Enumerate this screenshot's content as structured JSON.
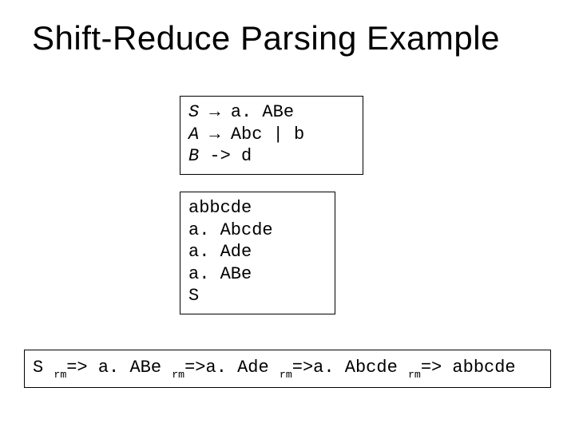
{
  "title": "Shift-Reduce Parsing Example",
  "grammar": {
    "rule1": {
      "lhs": "S",
      "arrow": "→",
      "rhs": "a. ABe"
    },
    "rule2": {
      "lhs": "A",
      "arrow": "→",
      "rhs": "Abc | b"
    },
    "rule3": {
      "lhs": "B",
      "arrow": "->",
      "rhs": "d"
    }
  },
  "reduction_steps": {
    "s1": "abbcde",
    "s2": "a. Abcde",
    "s3": "a. Ade",
    "s4": "a. ABe",
    "s5": "S"
  },
  "derivation": {
    "start": "S",
    "sub": "rm",
    "d1": "=> a. ABe",
    "d2": "=>a. Ade",
    "d3": "=>a. Abcde",
    "d4": "=> abbcde"
  }
}
